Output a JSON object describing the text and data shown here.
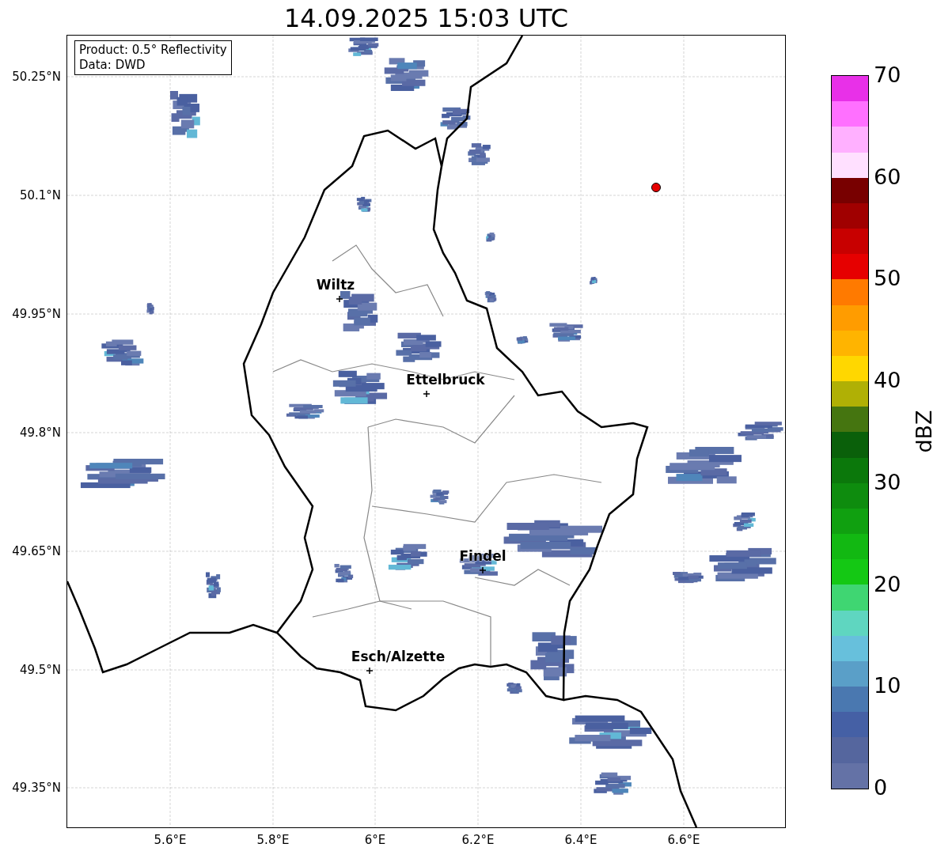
{
  "title": "14.09.2025 15:03 UTC",
  "info_box": [
    "Product: 0.5° Reflectivity",
    "Data: DWD"
  ],
  "map": {
    "lat_ticks": [
      "50.25°N",
      "50.1°N",
      "49.95°N",
      "49.8°N",
      "49.65°N",
      "49.5°N",
      "49.35°N"
    ],
    "lon_ticks": [
      "5.6°E",
      "5.8°E",
      "6°E",
      "6.2°E",
      "6.4°E",
      "6.6°E"
    ],
    "places": [
      {
        "name": "Wiltz"
      },
      {
        "name": "Ettelbruck"
      },
      {
        "name": "Findel"
      },
      {
        "name": "Esch/Alzette"
      }
    ]
  },
  "colorbar": {
    "label": "dBZ",
    "ticks": [
      "70",
      "60",
      "50",
      "40",
      "30",
      "20",
      "10",
      "0"
    ],
    "levels": [
      {
        "color": "#e830e8"
      },
      {
        "color": "#ff70ff"
      },
      {
        "color": "#ffb0ff"
      },
      {
        "color": "#ffe0ff"
      },
      {
        "color": "#780000"
      },
      {
        "color": "#a00000"
      },
      {
        "color": "#c80000"
      },
      {
        "color": "#e60000"
      },
      {
        "color": "#ff7a00"
      },
      {
        "color": "#ff9c00"
      },
      {
        "color": "#ffb400"
      },
      {
        "color": "#ffd700"
      },
      {
        "color": "#b0b005"
      },
      {
        "color": "#457510"
      },
      {
        "color": "#0a600a"
      },
      {
        "color": "#0b780b"
      },
      {
        "color": "#0e8c0e"
      },
      {
        "color": "#10a010"
      },
      {
        "color": "#12b812"
      },
      {
        "color": "#14c814"
      },
      {
        "color": "#3fd672"
      },
      {
        "color": "#5fd6c0"
      },
      {
        "color": "#67c0dc"
      },
      {
        "color": "#5a9fc8"
      },
      {
        "color": "#4a78b0"
      },
      {
        "color": "#4560a5"
      },
      {
        "color": "#55669e"
      },
      {
        "color": "#6472a6"
      }
    ]
  }
}
